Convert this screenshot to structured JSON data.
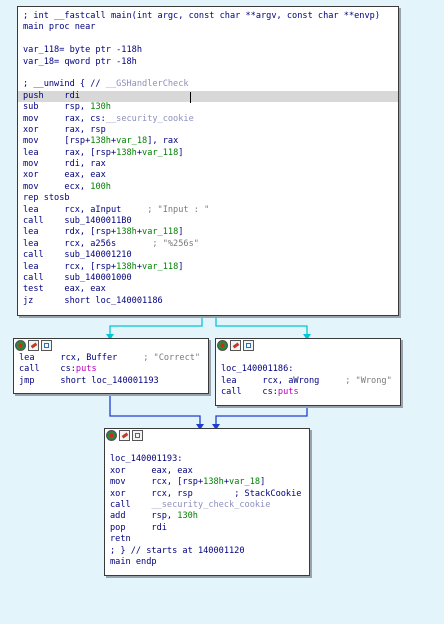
{
  "colors": {
    "background": "#e3f4fb",
    "code": "#000080",
    "comment": "#7a7a7a",
    "number": "#008000",
    "import": "#c000c0",
    "highlight": "#d8d8d8",
    "edge_true": "#00c8d8",
    "edge_flow": "#1e3fd6"
  },
  "icons": [
    "color-node-icon",
    "edit-node-icon",
    "graph-node-icon"
  ],
  "block_main": {
    "lines": [
      [
        [
          "",
          "; int __fastcall main(int argc, const char **argv, const char **envp)"
        ]
      ],
      [
        [
          "",
          "main proc near"
        ]
      ],
      [
        [
          "",
          ""
        ]
      ],
      [
        [
          "",
          "var_118= byte ptr -118h"
        ]
      ],
      [
        [
          "",
          "var_18= qword ptr -18h"
        ]
      ],
      [
        [
          "",
          ""
        ]
      ],
      [
        [
          "",
          "; __unwind { // "
        ],
        [
          "g",
          "__GSHandlerCheck"
        ]
      ],
      [
        [
          "",
          "push    rdi"
        ]
      ],
      [
        [
          "",
          "sub     rsp, "
        ],
        [
          "n",
          "130h"
        ]
      ],
      [
        [
          "",
          "mov     rax, cs:"
        ],
        [
          "g",
          "__security_cookie"
        ]
      ],
      [
        [
          "",
          "xor     rax, rsp"
        ]
      ],
      [
        [
          "",
          "mov     [rsp+"
        ],
        [
          "n",
          "138h"
        ],
        [
          "",
          "+"
        ],
        [
          "n",
          "var_18"
        ],
        [
          "",
          "], rax"
        ]
      ],
      [
        [
          "",
          "lea     rax, [rsp+"
        ],
        [
          "n",
          "138h"
        ],
        [
          "",
          "+"
        ],
        [
          "n",
          "var_118"
        ],
        [
          "",
          "]"
        ]
      ],
      [
        [
          "",
          "mov     rdi, rax"
        ]
      ],
      [
        [
          "",
          "xor     eax, eax"
        ]
      ],
      [
        [
          "",
          "mov     ecx, "
        ],
        [
          "n",
          "100h"
        ]
      ],
      [
        [
          "",
          "rep stosb"
        ]
      ],
      [
        [
          "",
          "lea     rcx, aInput     "
        ],
        [
          "c",
          "; \"Input : \""
        ]
      ],
      [
        [
          "",
          "call    sub_1400011B0"
        ]
      ],
      [
        [
          "",
          "lea     rdx, [rsp+"
        ],
        [
          "n",
          "138h"
        ],
        [
          "",
          "+"
        ],
        [
          "n",
          "var_118"
        ],
        [
          "",
          "]"
        ]
      ],
      [
        [
          "",
          "lea     rcx, a256s       "
        ],
        [
          "c",
          "; \"%256s\""
        ]
      ],
      [
        [
          "",
          "call    sub_140001210"
        ]
      ],
      [
        [
          "",
          "lea     rcx, [rsp+"
        ],
        [
          "n",
          "138h"
        ],
        [
          "",
          "+"
        ],
        [
          "n",
          "var_118"
        ],
        [
          "",
          "]"
        ]
      ],
      [
        [
          "",
          "call    sub_140001000"
        ]
      ],
      [
        [
          "",
          "test    eax, eax"
        ]
      ],
      [
        [
          "",
          "jz      short loc_140001186"
        ]
      ]
    ]
  },
  "block_correct": {
    "lines": [
      [
        [
          "",
          "lea     rcx, Buffer     "
        ],
        [
          "c",
          "; \"Correct\""
        ]
      ],
      [
        [
          "",
          "call    cs:"
        ],
        [
          "p",
          "puts"
        ]
      ],
      [
        [
          "",
          "jmp     short loc_140001193"
        ]
      ]
    ]
  },
  "block_wrong": {
    "lines": [
      [
        [
          "",
          ""
        ]
      ],
      [
        [
          "",
          "loc_140001186:"
        ]
      ],
      [
        [
          "",
          "lea     rcx, aWrong     "
        ],
        [
          "c",
          "; \"Wrong\""
        ]
      ],
      [
        [
          "",
          "call    cs:"
        ],
        [
          "p",
          "puts"
        ]
      ]
    ]
  },
  "block_end": {
    "lines": [
      [
        [
          "",
          ""
        ]
      ],
      [
        [
          "",
          "loc_140001193:"
        ]
      ],
      [
        [
          "",
          "xor     eax, eax"
        ]
      ],
      [
        [
          "",
          "mov     rcx, [rsp+"
        ],
        [
          "n",
          "138h"
        ],
        [
          "",
          "+"
        ],
        [
          "n",
          "var_18"
        ],
        [
          "",
          "]"
        ]
      ],
      [
        [
          "",
          "xor     rcx, rsp        "
        ],
        [
          "",
          "; StackCookie"
        ]
      ],
      [
        [
          "",
          "call    "
        ],
        [
          "g",
          "__security_check_cookie"
        ]
      ],
      [
        [
          "",
          "add     rsp, "
        ],
        [
          "n",
          "130h"
        ]
      ],
      [
        [
          "",
          "pop     rdi"
        ]
      ],
      [
        [
          "",
          "retn"
        ]
      ],
      [
        [
          "",
          "; } // starts at 140001120"
        ]
      ],
      [
        [
          "",
          "main endp"
        ]
      ]
    ]
  }
}
